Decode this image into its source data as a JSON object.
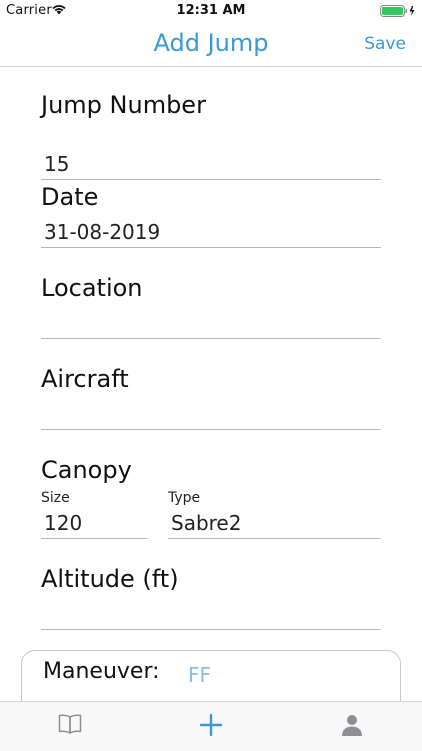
{
  "status_bar": {
    "carrier": "Carrier",
    "time": "12:31 AM"
  },
  "nav": {
    "title": "Add Jump",
    "save_label": "Save",
    "accent_color": "#3b99d4"
  },
  "form": {
    "jump_number": {
      "label": "Jump Number",
      "value": "15"
    },
    "date": {
      "label": "Date",
      "value": "31-08-2019"
    },
    "location": {
      "label": "Location",
      "value": ""
    },
    "aircraft": {
      "label": "Aircraft",
      "value": ""
    },
    "canopy": {
      "label": "Canopy",
      "size_label": "Size",
      "size_value": "120",
      "type_label": "Type",
      "type_value": "Sabre2"
    },
    "altitude": {
      "label": "Altitude (ft)",
      "value": ""
    }
  },
  "maneuver": {
    "label": "Maneuver:",
    "value": "FF"
  },
  "tab_bar": {
    "tabs": [
      {
        "icon": "book-icon",
        "active": false
      },
      {
        "icon": "plus-icon",
        "active": true
      },
      {
        "icon": "person-icon",
        "active": false
      }
    ]
  }
}
